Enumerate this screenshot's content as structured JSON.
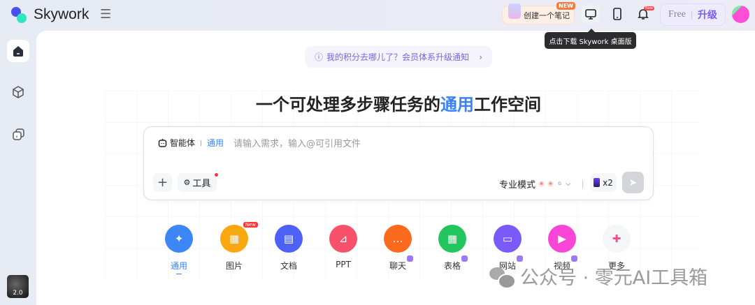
{
  "header": {
    "app_name": "Skywork",
    "create_note": "创建一个笔记",
    "create_note_badge": "NEW",
    "bell_badge": "New",
    "plan": "Free",
    "upgrade": "升级",
    "tooltip": "点击下载 Skywork 桌面版"
  },
  "sidebar": {
    "version": "2.0"
  },
  "notice": {
    "text": "我的积分去哪儿了？会员体系升级通知"
  },
  "headline": {
    "before": "一个可处理多步骤任务的",
    "highlight": "通用",
    "after": "工作空间"
  },
  "composer": {
    "agent_label": "智能体",
    "agent_type": "通用",
    "placeholder": "请输入需求，输入@可引用文件",
    "tools_label": "工具",
    "mode_label": "专业模式",
    "multiplier": "x2"
  },
  "categories": [
    {
      "label": "通用",
      "color": "#3d86f6",
      "glyph": "✦"
    },
    {
      "label": "图片",
      "color": "#fba70f",
      "glyph": "▦",
      "badge": "New"
    },
    {
      "label": "文档",
      "color": "#4e61f6",
      "glyph": "▤"
    },
    {
      "label": "PPT",
      "color": "#f7516b",
      "glyph": "⊿"
    },
    {
      "label": "聊天",
      "color": "#fb6a1d",
      "glyph": "…"
    },
    {
      "label": "表格",
      "color": "#23c55e",
      "glyph": "▦"
    },
    {
      "label": "网站",
      "color": "#7a5af8",
      "glyph": "▭"
    },
    {
      "label": "视频",
      "color": "#fa46d6",
      "glyph": "▶"
    },
    {
      "label": "更多",
      "color": "#f5f6f8",
      "glyph": "✚"
    }
  ],
  "watermark": "公众号 · 零元AI工具箱"
}
